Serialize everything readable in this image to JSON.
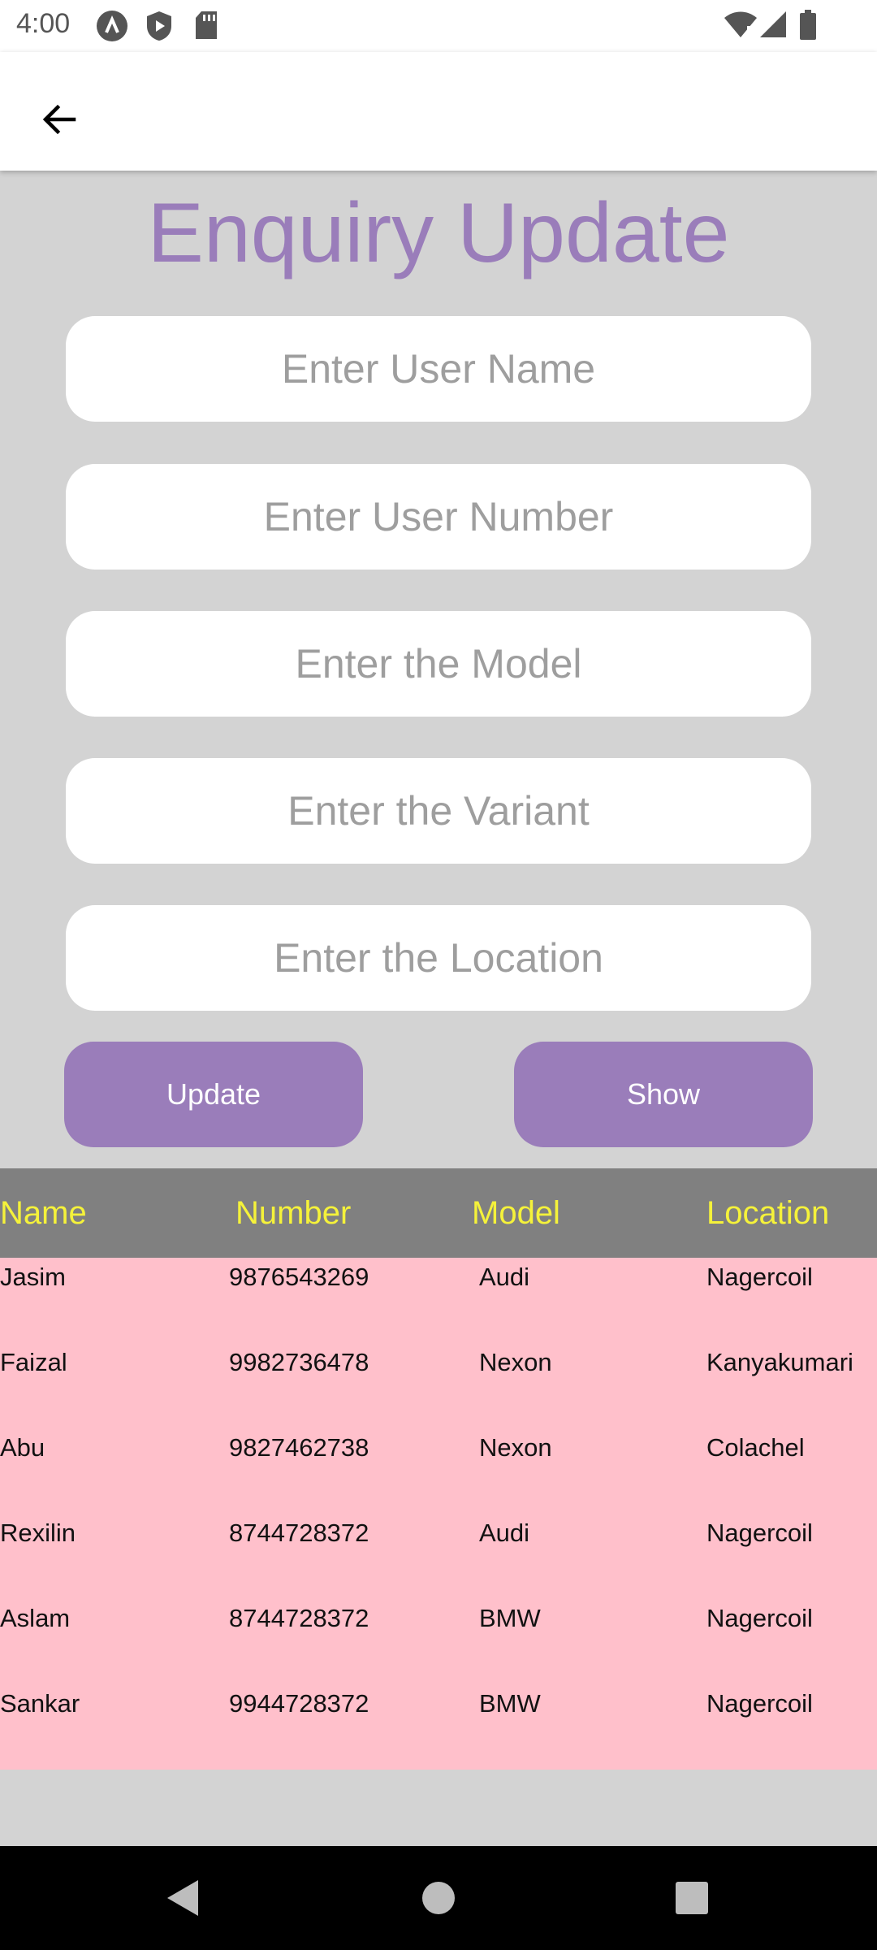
{
  "status_bar": {
    "time": "4:00",
    "icons": [
      "app-notification-icon",
      "shield-icon",
      "sd-card-icon",
      "wifi-icon",
      "signal-icon",
      "battery-icon"
    ]
  },
  "app_bar": {
    "back_icon": "arrow-back-icon"
  },
  "title": "Enquiry Update",
  "form": {
    "user_name": {
      "value": "",
      "placeholder": "Enter User Name"
    },
    "user_number": {
      "value": "",
      "placeholder": "Enter User Number"
    },
    "model": {
      "value": "",
      "placeholder": "Enter the Model"
    },
    "variant": {
      "value": "",
      "placeholder": "Enter the Variant"
    },
    "location": {
      "value": "",
      "placeholder": "Enter the Location"
    }
  },
  "buttons": {
    "update": "Update",
    "show": "Show"
  },
  "table": {
    "headers": [
      "Name",
      "Number",
      "Model",
      "Location"
    ],
    "rows": [
      [
        "Jasim",
        "9876543269",
        "Audi",
        "Nagercoil"
      ],
      [
        "Faizal",
        "9982736478",
        "Nexon",
        "Kanyakumari"
      ],
      [
        "Abu",
        "9827462738",
        "Nexon",
        "Colachel"
      ],
      [
        "Rexilin",
        "8744728372",
        "Audi",
        "Nagercoil"
      ],
      [
        "Aslam",
        "8744728372",
        "BMW",
        "Nagercoil"
      ],
      [
        "Sankar",
        "9944728372",
        "BMW",
        "Nagercoil"
      ]
    ]
  },
  "nav_bar": {
    "icons": [
      "back-triangle-icon",
      "home-circle-icon",
      "recents-square-icon"
    ]
  },
  "colors": {
    "accent": "#9a7dba",
    "background": "#d3d3d3",
    "table_header_bg": "#808080",
    "table_header_text": "#f5f23a",
    "table_body_bg": "#ffc0cb"
  }
}
